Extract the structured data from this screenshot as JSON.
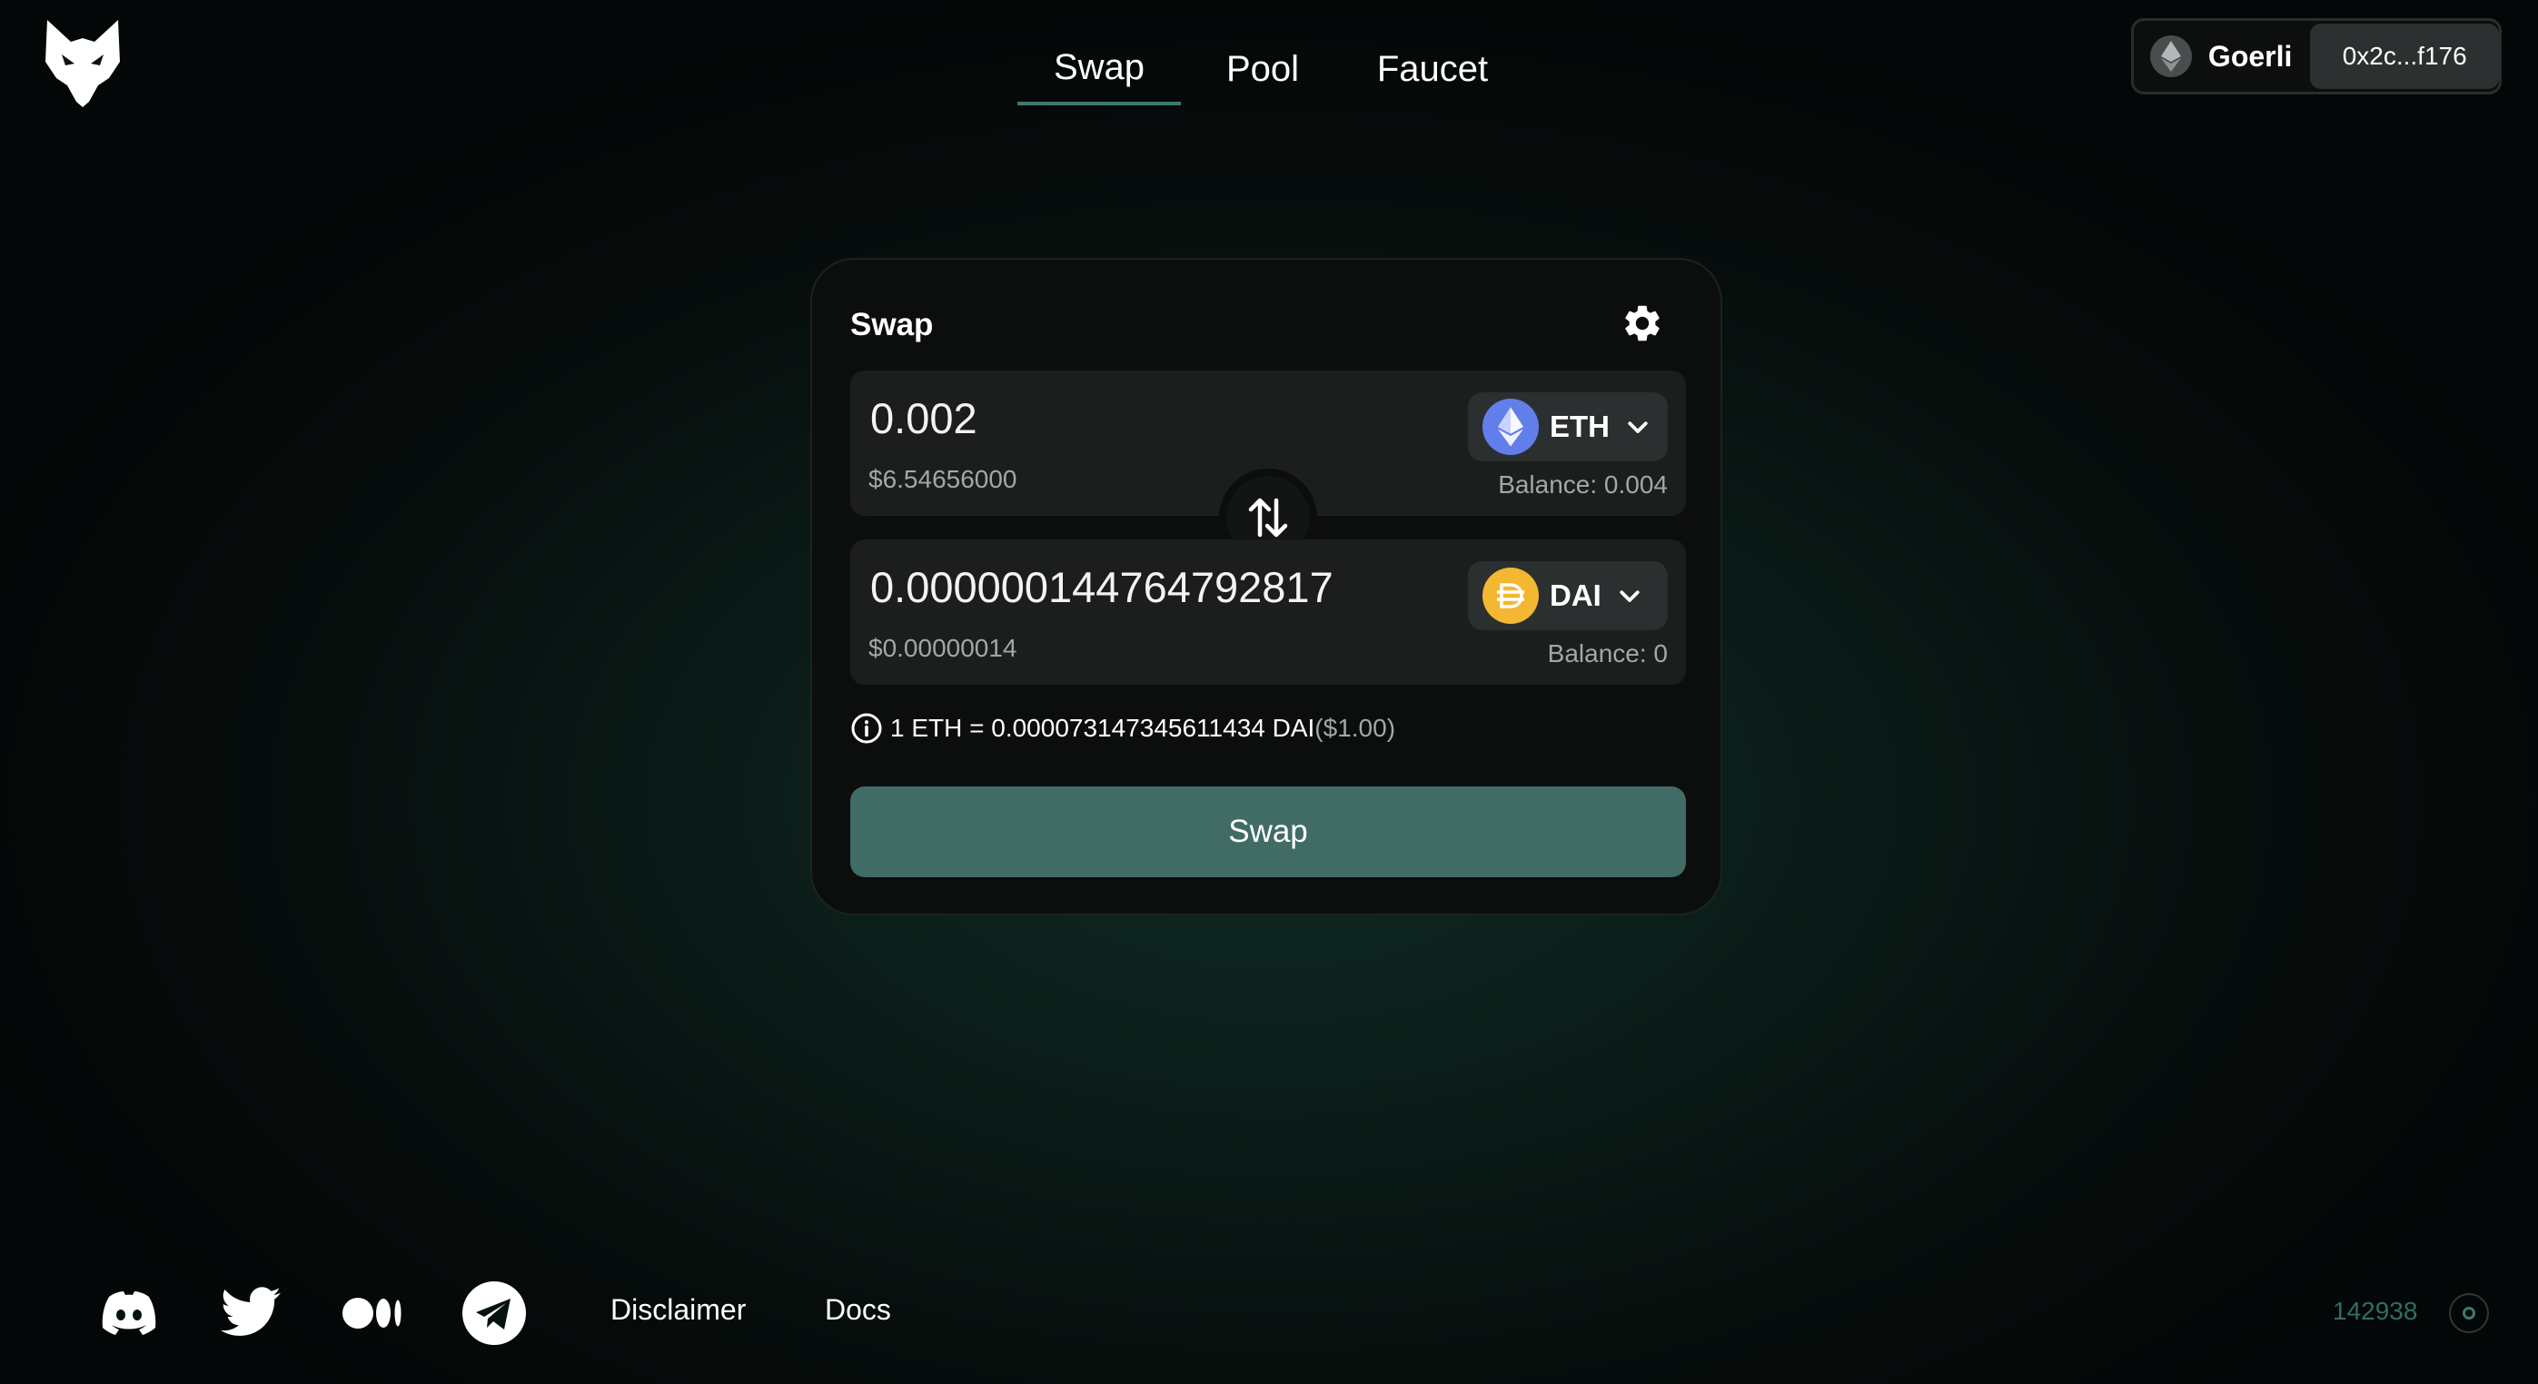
{
  "header": {
    "logo": "lynx-logo-icon",
    "nav": [
      {
        "label": "Swap",
        "active": true
      },
      {
        "label": "Pool",
        "active": false
      },
      {
        "label": "Faucet",
        "active": false
      }
    ],
    "network": {
      "icon": "ethereum-icon",
      "name": "Goerli"
    },
    "address": "0x2c...f176"
  },
  "swap": {
    "title": "Swap",
    "settings_icon": "gear-icon",
    "from": {
      "amount": "0.002",
      "usd": "$6.54656000",
      "token": "ETH",
      "token_icon": "eth-icon",
      "balance": "Balance: 0.004"
    },
    "to": {
      "amount": "0.000000144764792817",
      "usd": "$0.00000014",
      "token": "DAI",
      "token_icon": "dai-icon",
      "balance": "Balance: 0"
    },
    "flip_icon": "swap-arrows-icon",
    "rate": {
      "text": "1 ETH = 0.000073147345611434 DAI",
      "fiat": "($1.00)"
    },
    "button_label": "Swap"
  },
  "footer": {
    "socials": [
      "discord-icon",
      "twitter-icon",
      "medium-icon",
      "telegram-icon"
    ],
    "links": [
      "Disclaimer",
      "Docs"
    ],
    "block_number": "142938"
  },
  "colors": {
    "accent": "#3e7a6c",
    "swap_button": "#406c65",
    "eth": "#627eea",
    "dai": "#f4b731",
    "block_number": "#2f6f5f"
  }
}
